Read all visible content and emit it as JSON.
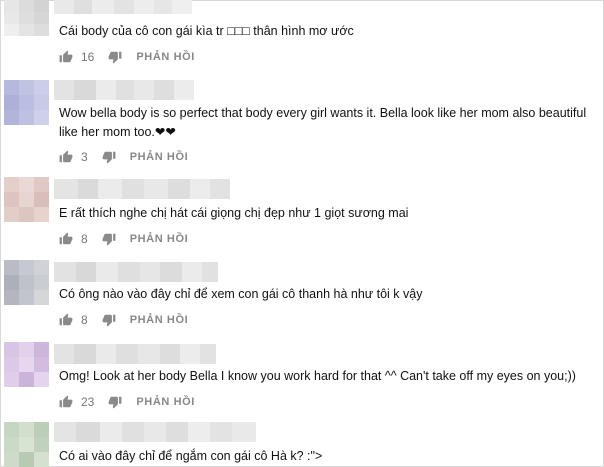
{
  "comments": [
    {
      "text": "Cái body của cô con gái kìa tr □□□ thân hình mơ ước",
      "likes": "16",
      "reply": "PHẢN HỒI",
      "avatar_colors": [
        "#e6e6e6",
        "#dcdcdc",
        "#d3d3d3",
        "#e8e8e8",
        "#dedede",
        "#d6d6d6",
        "#eeeeee",
        "#e4e4e4",
        "#dddddd"
      ]
    },
    {
      "text": "Wow bella body is so perfect that body every girl wants it. Bella look like her mom also beautiful like her mom too.❤❤",
      "likes": "3",
      "reply": "PHẢN HỒI",
      "avatar_colors": [
        "#b6b8dd",
        "#c1c3e3",
        "#cccde8",
        "#adb0d8",
        "#bcbee1",
        "#c8cae6",
        "#b2b4da",
        "#bfc1e2",
        "#cfd0e9"
      ]
    },
    {
      "text": "E rất thích nghe chị hát cái giọng chị đẹp như 1 giọt sương mai",
      "likes": "8",
      "reply": "PHẢN HỒI",
      "avatar_colors": [
        "#e4cfcb",
        "#ead8d4",
        "#e0c8c4",
        "#dcc4c0",
        "#e8d5d1",
        "#d8bfbb",
        "#e3cdc9",
        "#ddc6c2",
        "#e7d2ce"
      ]
    },
    {
      "text": "Có ông nào vào đây chỉ để xem con gái cô thanh hà như tôi k vậy",
      "likes": "8",
      "reply": "PHẢN HỒI",
      "avatar_colors": [
        "#b9bcc3",
        "#c6c9cf",
        "#d0d2d7",
        "#acb0b8",
        "#bfc2c9",
        "#cacdd2",
        "#b3b6be",
        "#c2c5cb",
        "#d4d6da"
      ]
    },
    {
      "text": "Omg! Look at her body Bella I know you work hard for that ^^ Can't take off my eyes on you;))",
      "likes": "23",
      "reply": "PHẢN HỒI",
      "avatar_colors": [
        "#d8c4e4",
        "#e2d1ec",
        "#cdb6dc",
        "#dcc9e7",
        "#e6d7ef",
        "#d2bde0",
        "#dfcde9",
        "#cbb3da",
        "#e4d4ee"
      ]
    },
    {
      "text": "Có ai vào đây chỉ để ngắm con gái cô Hà k? :\">",
      "likes": "",
      "reply": "",
      "avatar_colors": [
        "#c7d6c3",
        "#d2dfce",
        "#bccdb8",
        "#cbd9c7",
        "#d8e3d4",
        "#c1d1bd",
        "#cedbca",
        "#b8c9b4",
        "#d5e0d1"
      ]
    }
  ]
}
